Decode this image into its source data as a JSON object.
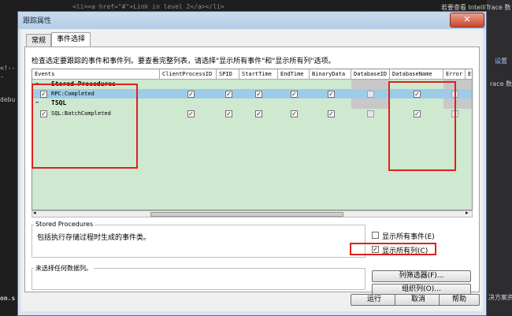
{
  "ide": {
    "top_code": "<li><a href=\"#\">Link in level 2</a></li>",
    "right_top": "若要查看 IntelliTrace 数",
    "right_settings": "设置",
    "right_trace": "race 数",
    "left_codes": [
      "<!--",
      "-",
      "debu"
    ],
    "bottom_left": "on.s",
    "bottom_right": "决方案资"
  },
  "dialog": {
    "title": "跟踪属性",
    "close_symbol": "✕",
    "tabs": [
      "常规",
      "事件选择"
    ],
    "instruction": "检查选定要跟踪的事件和事件列。要查看完整列表，请选择\"显示所有事件\"和\"显示所有列\"选项。",
    "grid": {
      "columns": [
        "Events",
        "ClientProcessID",
        "SPID",
        "StartTime",
        "EndTime",
        "BinaryData",
        "DatabaseID",
        "DatabaseName",
        "Error",
        "Ev"
      ],
      "rows": [
        {
          "kind": "category",
          "toggle": "−",
          "label": "Stored Procedures"
        },
        {
          "kind": "event",
          "check": "✓",
          "label": "RPC:Completed",
          "cols": [
            "✓",
            "✓",
            "✓",
            "✓",
            "✓",
            "",
            "✓",
            "",
            ""
          ]
        },
        {
          "kind": "category",
          "toggle": "−",
          "label": "TSQL"
        },
        {
          "kind": "event",
          "check": "✓",
          "label": "SQL:BatchCompleted",
          "cols": [
            "✓",
            "✓",
            "✓",
            "✓",
            "✓",
            "",
            "✓",
            "",
            ""
          ]
        }
      ]
    },
    "scroll_left": "◂",
    "scroll_right": "▸",
    "description": {
      "title": "Stored Procedures",
      "text": "包括执行存储过程时生成的事件类。"
    },
    "options": {
      "show_all_events": "显示所有事件(E)",
      "show_all_columns": "显示所有列(C)",
      "show_all_events_checked": false,
      "show_all_columns_checked": true
    },
    "column_info": "未选择任何数据列。",
    "buttons": {
      "column_filters": "列筛选器(F)...",
      "organize_columns": "组织列(O)...",
      "run": "运行",
      "cancel": "取消",
      "help": "帮助"
    },
    "colors": {
      "highlight_red": "#e0201e",
      "grid_green": "#cfe8d0",
      "selected_row": "#9ecce8"
    }
  }
}
